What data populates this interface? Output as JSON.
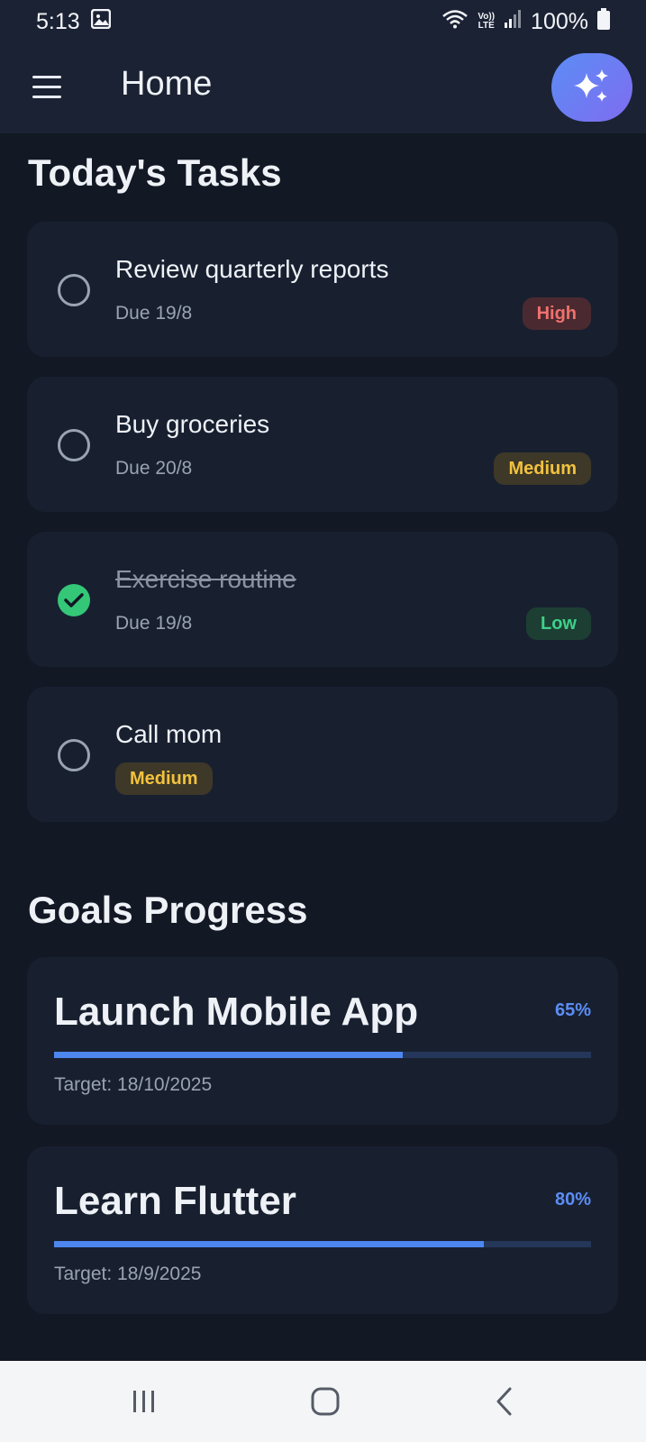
{
  "status_bar": {
    "time": "5:13",
    "lte_top": "Vo))",
    "lte_bottom": "LTE",
    "battery": "100%"
  },
  "app_bar": {
    "title": "Home"
  },
  "tasks_section": {
    "title": "Today's Tasks",
    "tasks": [
      {
        "title": "Review quarterly reports",
        "due": "Due 19/8",
        "priority": "High",
        "done": false
      },
      {
        "title": "Buy groceries",
        "due": "Due 20/8",
        "priority": "Medium",
        "done": false
      },
      {
        "title": "Exercise routine",
        "due": "Due 19/8",
        "priority": "Low",
        "done": true
      },
      {
        "title": "Call mom",
        "due": "",
        "priority": "Medium",
        "done": false
      }
    ]
  },
  "goals_section": {
    "title": "Goals Progress",
    "goals": [
      {
        "title": "Launch Mobile App",
        "percent_label": "65%",
        "progress": 0.65,
        "target": "Target: 18/10/2025"
      },
      {
        "title": "Learn Flutter",
        "percent_label": "80%",
        "progress": 0.8,
        "target": "Target: 18/9/2025"
      }
    ]
  },
  "colors": {
    "background": "#121824",
    "card": "#182030",
    "accent": "#5b8df5",
    "high": "#f0716d",
    "medium": "#f2c23e",
    "low": "#3ed08a"
  },
  "icons": {
    "menu": "hamburger-menu-icon",
    "ai": "sparkles-icon",
    "unchecked": "circle-outline-icon",
    "checked": "check-circle-icon"
  }
}
